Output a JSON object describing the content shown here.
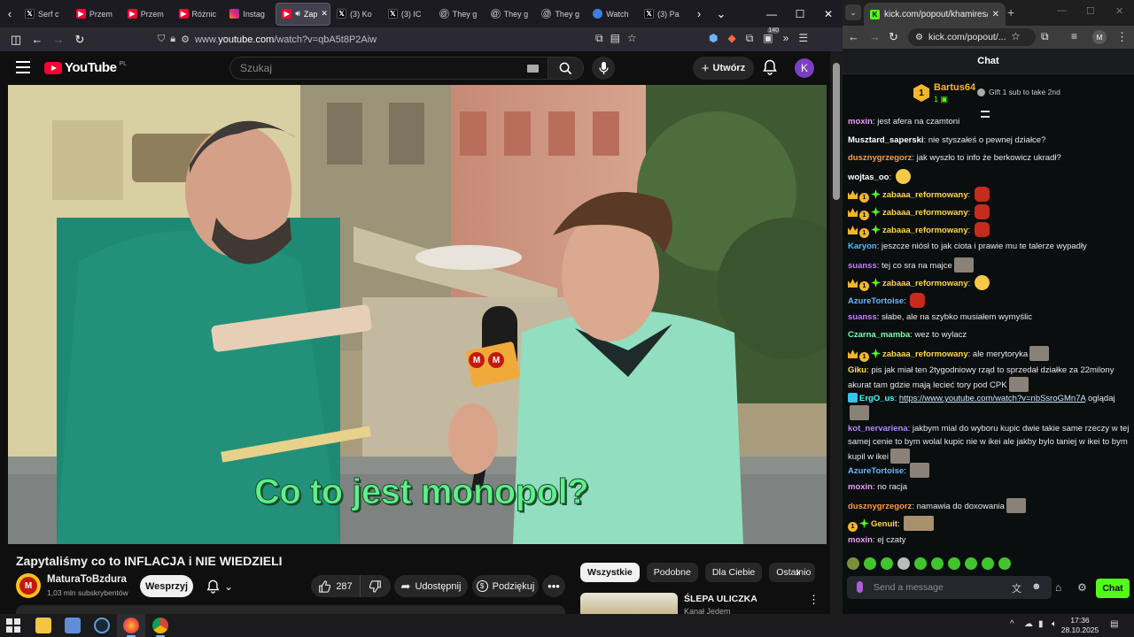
{
  "firefox": {
    "tabs": [
      {
        "icon": "x",
        "label": "Serf c"
      },
      {
        "icon": "yt",
        "label": "Przem"
      },
      {
        "icon": "yt",
        "label": "Przem"
      },
      {
        "icon": "yt",
        "label": "Różnic"
      },
      {
        "icon": "ig",
        "label": "Instag"
      },
      {
        "icon": "yt",
        "label": "Zap",
        "active": true
      },
      {
        "icon": "x",
        "label": "(3) Ko"
      },
      {
        "icon": "x",
        "label": "(3) IC"
      },
      {
        "icon": "th",
        "label": "They g"
      },
      {
        "icon": "th",
        "label": "They g"
      },
      {
        "icon": "th",
        "label": "They g"
      },
      {
        "icon": "w",
        "label": "Watch"
      },
      {
        "icon": "x",
        "label": "(3) Pa"
      }
    ],
    "url_prefix": "www.",
    "url_main": "youtube.com",
    "url_rest": "/watch?v=qbA5t8P2Aiw",
    "extension_badge": "140"
  },
  "youtube": {
    "logo_text": "YouTube",
    "region": "PL",
    "search_placeholder": "Szukaj",
    "create_label": "Utwórz",
    "avatar_letter": "K",
    "caption": "Co to jest monopol?",
    "mic_logo": "M",
    "title": "Zapytaliśmy co to INFLACJA i NIE WIEDZIELI",
    "channel": "MaturaToBzdura",
    "channel_logo": "M",
    "subscribers": "1,03 mln subskrybentów",
    "support_label": "Wesprzyj",
    "likes": "287",
    "share_label": "Udostępnij",
    "thanks_label": "Podziękuj",
    "chips": [
      "Wszystkie",
      "Podobne",
      "Dla Ciebie",
      "Ostatnio"
    ],
    "rec_title": "ŚLEPA ULICZKA",
    "rec_channel": "Kanał Jedem"
  },
  "chrome": {
    "tab_title": "kick.com/popout/khamires/chat",
    "url": "kick.com/popout/...",
    "profile_letter": "M"
  },
  "kick": {
    "header": "Chat",
    "pinned": {
      "rank": "1",
      "name": "Bartus64",
      "count": "1",
      "gift_label": "Gift 1 sub to take 2nd"
    },
    "messages": [
      {
        "user": "moxin",
        "color": "#f09aff",
        "text": "jest afera na czamtoni"
      },
      {
        "user": "Musztard_saperski",
        "color": "#ffffff",
        "text": "nie styszałeś o pewnej działce?"
      },
      {
        "user": "dusznygrzegorz",
        "color": "#ff9d3c",
        "text": "jak wyszło to info że berkowicz ukradł?"
      },
      {
        "user": "wojtas_oo",
        "color": "#ffffff",
        "text": ""
      },
      {
        "user": "zabaaa_reformowany",
        "color": "#ffd84a",
        "text": ""
      },
      {
        "user": "zabaaa_reformowany",
        "color": "#ffd84a",
        "text": ""
      },
      {
        "user": "zabaaa_reformowany",
        "color": "#ffd84a",
        "text": ""
      },
      {
        "user": "Karyon",
        "color": "#3fc8ff",
        "text": "jeszcze niósł to jak ciota i prawie mu te talerze wypadły"
      },
      {
        "user": "suanss",
        "color": "#c77dff",
        "text": "tej co sra na majce"
      },
      {
        "user": "zabaaa_reformowany",
        "color": "#ffd84a",
        "text": ""
      },
      {
        "user": "AzureTortoise",
        "color": "#6ab7ff",
        "text": ""
      },
      {
        "user": "suanss",
        "color": "#c77dff",
        "text": "słabe, ale na szybko musiałem wymyślic"
      },
      {
        "user": "Czarna_mamba",
        "color": "#7dffb0",
        "text": "wez to wylacz"
      },
      {
        "user": "zabaaa_reformowany",
        "color": "#ffd84a",
        "text": "ale merytoryka"
      },
      {
        "user": "Giku",
        "color": "#ffe14d",
        "text": "pis jak miał ten 2tygodniowy rząd to sprzedał działke za 22milony akurat tam gdzie mają lecieć tory pod CPK"
      },
      {
        "user": "ErgO_us",
        "color": "#53fcff",
        "text": "oglądaj",
        "link": "https://www.youtube.com/watch?v=nbSsroGMn7A"
      },
      {
        "user": "kot_nervariena",
        "color": "#b28dff",
        "text": "jakbym mial do wyboru kupic dwie takie same rzeczy w tej samej cenie to bym wolal kupic nie w ikei ale jakby bylo taniej w ikei to bym kupil w ikei"
      },
      {
        "user": "AzureTortoise",
        "color": "#6ab7ff",
        "text": ""
      },
      {
        "user": "moxin",
        "color": "#f09aff",
        "text": "no racja"
      },
      {
        "user": "dusznygrzegorz",
        "color": "#ff9d3c",
        "text": "namawia do doxowania"
      },
      {
        "user": "Genuit",
        "color": "#ffd84a",
        "text": ""
      },
      {
        "user": "moxin",
        "color": "#f09aff",
        "text": "ej czaty"
      }
    ],
    "input_placeholder": "Send a message",
    "send_label": "Chat",
    "badge_one": "1"
  },
  "taskbar": {
    "time": "17:36",
    "date": "28.10.2025"
  }
}
